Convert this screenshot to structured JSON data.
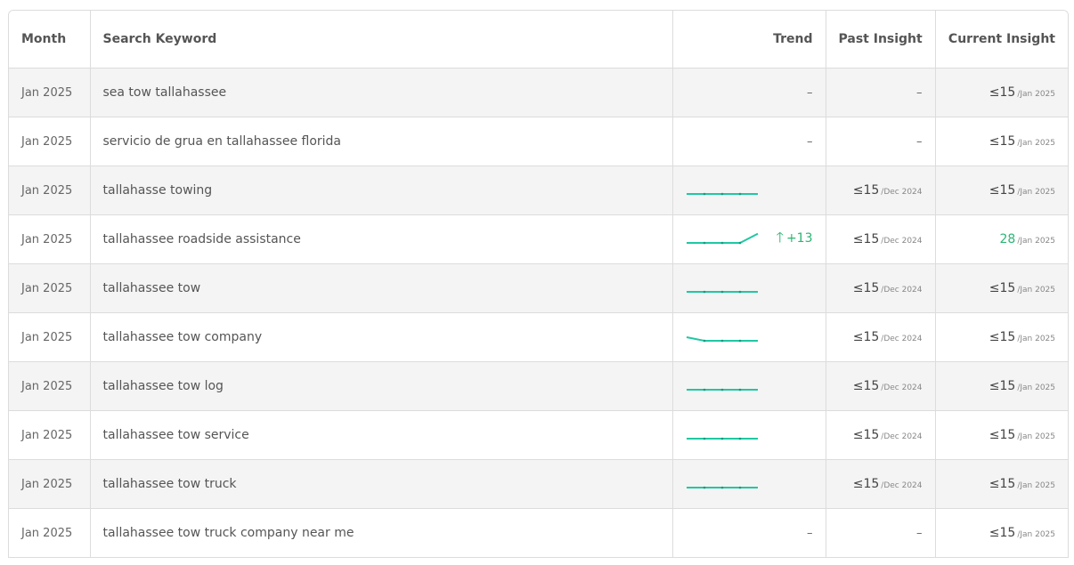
{
  "headers": {
    "month": "Month",
    "keyword": "Search Keyword",
    "trend": "Trend",
    "past": "Past Insight",
    "current": "Current Insight"
  },
  "colors": {
    "spark": "#1fc8a3",
    "positive": "#2bb673"
  },
  "rows": [
    {
      "month": "Jan 2025",
      "keyword": "sea tow tallahassee",
      "trend_text": "–",
      "past": "–",
      "past_date": "",
      "current": "≤15",
      "current_date": "/Jan 2025"
    },
    {
      "month": "Jan 2025",
      "keyword": "servicio de grua en tallahassee florida",
      "trend_text": "–",
      "past": "–",
      "past_date": "",
      "current": "≤15",
      "current_date": "/Jan 2025"
    },
    {
      "month": "Jan 2025",
      "keyword": "tallahasse towing",
      "trend_values": [
        15,
        15,
        15,
        15,
        15
      ],
      "past": "≤15",
      "past_date": "/Dec 2024",
      "current": "≤15",
      "current_date": "/Jan 2025"
    },
    {
      "month": "Jan 2025",
      "keyword": "tallahassee roadside assistance",
      "trend_values": [
        15,
        15,
        15,
        15,
        28
      ],
      "trend_change": "+13",
      "past": "≤15",
      "past_date": "/Dec 2024",
      "current": "28",
      "current_date": "/Jan 2025"
    },
    {
      "month": "Jan 2025",
      "keyword": "tallahassee tow",
      "trend_values": [
        15,
        15,
        15,
        15,
        15
      ],
      "past": "≤15",
      "past_date": "/Dec 2024",
      "current": "≤15",
      "current_date": "/Jan 2025"
    },
    {
      "month": "Jan 2025",
      "keyword": "tallahassee tow company",
      "trend_values": [
        20,
        15,
        15,
        15,
        15
      ],
      "past": "≤15",
      "past_date": "/Dec 2024",
      "current": "≤15",
      "current_date": "/Jan 2025"
    },
    {
      "month": "Jan 2025",
      "keyword": "tallahassee tow log",
      "trend_values": [
        15,
        15,
        15,
        15,
        15
      ],
      "past": "≤15",
      "past_date": "/Dec 2024",
      "current": "≤15",
      "current_date": "/Jan 2025"
    },
    {
      "month": "Jan 2025",
      "keyword": "tallahassee tow service",
      "trend_values": [
        15,
        15,
        15,
        15,
        15
      ],
      "past": "≤15",
      "past_date": "/Dec 2024",
      "current": "≤15",
      "current_date": "/Jan 2025"
    },
    {
      "month": "Jan 2025",
      "keyword": "tallahassee tow truck",
      "trend_values": [
        15,
        15,
        15,
        15,
        15
      ],
      "past": "≤15",
      "past_date": "/Dec 2024",
      "current": "≤15",
      "current_date": "/Jan 2025"
    },
    {
      "month": "Jan 2025",
      "keyword": "tallahassee tow truck company near me",
      "trend_text": "–",
      "past": "–",
      "past_date": "",
      "current": "≤15",
      "current_date": "/Jan 2025"
    }
  ]
}
